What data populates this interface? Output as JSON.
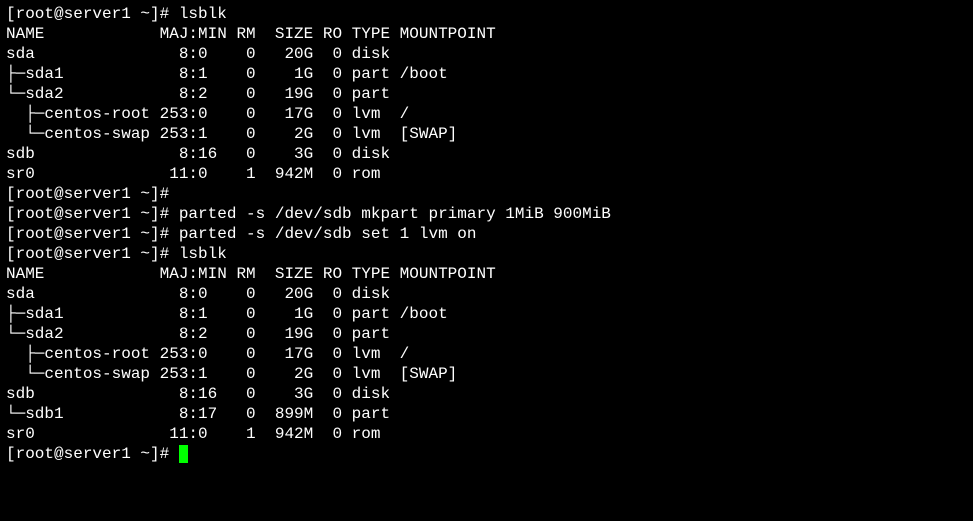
{
  "session": {
    "prompt": "[root@server1 ~]# ",
    "lines": [
      {
        "type": "cmd",
        "text": "lsblk"
      },
      {
        "type": "header",
        "text": "NAME            MAJ:MIN RM  SIZE RO TYPE MOUNTPOINT"
      },
      {
        "type": "row",
        "text": "sda               8:0    0   20G  0 disk "
      },
      {
        "type": "row",
        "text": "├─sda1            8:1    0    1G  0 part /boot"
      },
      {
        "type": "row",
        "text": "└─sda2            8:2    0   19G  0 part "
      },
      {
        "type": "row",
        "text": "  ├─centos-root 253:0    0   17G  0 lvm  /"
      },
      {
        "type": "row",
        "text": "  └─centos-swap 253:1    0    2G  0 lvm  [SWAP]"
      },
      {
        "type": "row",
        "text": "sdb               8:16   0    3G  0 disk "
      },
      {
        "type": "row",
        "text": "sr0              11:0    1  942M  0 rom  "
      },
      {
        "type": "cmd",
        "text": ""
      },
      {
        "type": "cmd",
        "text": "parted -s /dev/sdb mkpart primary 1MiB 900MiB"
      },
      {
        "type": "cmd",
        "text": "parted -s /dev/sdb set 1 lvm on"
      },
      {
        "type": "cmd",
        "text": "lsblk"
      },
      {
        "type": "header",
        "text": "NAME            MAJ:MIN RM  SIZE RO TYPE MOUNTPOINT"
      },
      {
        "type": "row",
        "text": "sda               8:0    0   20G  0 disk "
      },
      {
        "type": "row",
        "text": "├─sda1            8:1    0    1G  0 part /boot"
      },
      {
        "type": "row",
        "text": "└─sda2            8:2    0   19G  0 part "
      },
      {
        "type": "row",
        "text": "  ├─centos-root 253:0    0   17G  0 lvm  /"
      },
      {
        "type": "row",
        "text": "  └─centos-swap 253:1    0    2G  0 lvm  [SWAP]"
      },
      {
        "type": "row",
        "text": "sdb               8:16   0    3G  0 disk "
      },
      {
        "type": "row",
        "text": "└─sdb1            8:17   0  899M  0 part "
      },
      {
        "type": "row",
        "text": "sr0              11:0    1  942M  0 rom  "
      },
      {
        "type": "cursor",
        "text": ""
      }
    ]
  }
}
